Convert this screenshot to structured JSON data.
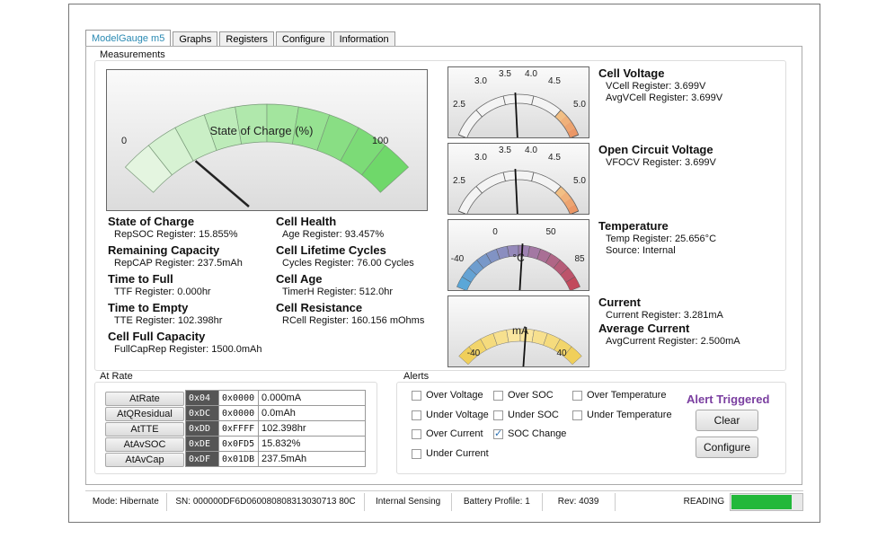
{
  "tabs": [
    "ModelGauge m5",
    "Graphs",
    "Registers",
    "Configure",
    "Information"
  ],
  "measurements_label": "Measurements",
  "soc_gauge": {
    "label": "State of Charge (%)",
    "min": "0",
    "max": "100",
    "value": 15.855
  },
  "left_metrics": [
    {
      "title": "State of Charge",
      "detail": "RepSOC Register: 15.855%"
    },
    {
      "title": "Remaining Capacity",
      "detail": "RepCAP Register: 237.5mAh"
    },
    {
      "title": "Time to Full",
      "detail": "TTF Register: 0.000hr"
    },
    {
      "title": "Time to Empty",
      "detail": "TTE Register: 102.398hr"
    },
    {
      "title": "Cell Full Capacity",
      "detail": "FullCapRep Register: 1500.0mAh"
    }
  ],
  "mid_metrics": [
    {
      "title": "Cell Health",
      "detail": "Age Register: 93.457%"
    },
    {
      "title": "Cell Lifetime Cycles",
      "detail": "Cycles Register: 76.00 Cycles"
    },
    {
      "title": "Cell Age",
      "detail": "TimerH Register: 512.0hr"
    },
    {
      "title": "Cell Resistance",
      "detail": "RCell Register: 160.156 mOhms"
    }
  ],
  "voltage_scale": [
    "2.5",
    "3.0",
    "3.5",
    "4.0",
    "4.5",
    "5.0"
  ],
  "cell_voltage": {
    "title": "Cell Voltage",
    "lines": [
      "VCell Register: 3.699V",
      "AvgVCell Register: 3.699V"
    ],
    "value": 3.699
  },
  "ocv": {
    "title": "Open Circuit Voltage",
    "lines": [
      "VFOCV Register: 3.699V"
    ],
    "value": 3.699
  },
  "temperature": {
    "title": "Temperature",
    "lines": [
      "Temp Register: 25.656°C",
      "Source: Internal"
    ],
    "scale": [
      "-40",
      "0",
      "50",
      "85"
    ],
    "unit": "°C",
    "value": 25.656
  },
  "current": {
    "title": "Current",
    "lines": [
      "Current Register: 3.281mA"
    ],
    "avg_title": "Average Current",
    "avg_lines": [
      "AvgCurrent Register: 2.500mA"
    ],
    "scale": [
      "-40",
      "40"
    ],
    "unit": "mA",
    "value": 3.281
  },
  "at_rate": {
    "label": "At Rate",
    "rows": [
      {
        "name": "AtRate",
        "addr": "0x04",
        "hex": "0x0000",
        "value": "0.000mA"
      },
      {
        "name": "AtQResidual",
        "addr": "0xDC",
        "hex": "0x0000",
        "value": "0.0mAh"
      },
      {
        "name": "AtTTE",
        "addr": "0xDD",
        "hex": "0xFFFF",
        "value": "102.398hr"
      },
      {
        "name": "AtAvSOC",
        "addr": "0xDE",
        "hex": "0x0FD5",
        "value": "15.832%"
      },
      {
        "name": "AtAvCap",
        "addr": "0xDF",
        "hex": "0x01DB",
        "value": "237.5mAh"
      }
    ]
  },
  "alerts": {
    "label": "Alerts",
    "items": [
      {
        "label": "Over Voltage",
        "checked": false
      },
      {
        "label": "Under Voltage",
        "checked": false
      },
      {
        "label": "Over Current",
        "checked": false
      },
      {
        "label": "Under Current",
        "checked": false
      },
      {
        "label": "Over SOC",
        "checked": false
      },
      {
        "label": "Under SOC",
        "checked": false
      },
      {
        "label": "SOC Change",
        "checked": true
      },
      {
        "label": "Over Temperature",
        "checked": false
      },
      {
        "label": "Under Temperature",
        "checked": false
      }
    ],
    "triggered": "Alert Triggered",
    "clear_label": "Clear",
    "configure_label": "Configure"
  },
  "status": {
    "mode": "Mode: Hibernate",
    "sn": "SN: 000000DF6D060080808313030713 80C",
    "sensing": "Internal Sensing",
    "profile": "Battery Profile: 1",
    "rev": "Rev: 4039",
    "reading": "READING",
    "progress": 1.0
  },
  "colors": {
    "accent": "#2a8ab3",
    "triggered": "#7a3ea0",
    "progress": "#22b83a"
  }
}
